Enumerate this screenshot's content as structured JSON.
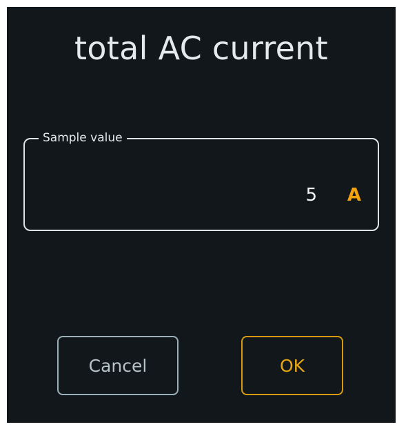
{
  "dialog": {
    "title": "total AC current",
    "field": {
      "label": "Sample value",
      "value": "5",
      "unit": "A"
    },
    "buttons": {
      "cancel_label": "Cancel",
      "ok_label": "OK"
    }
  },
  "colors": {
    "background": "#12171b",
    "accent": "#f2a20c",
    "text": "#e6e9ec",
    "cancel_border": "#9cb0ba"
  }
}
